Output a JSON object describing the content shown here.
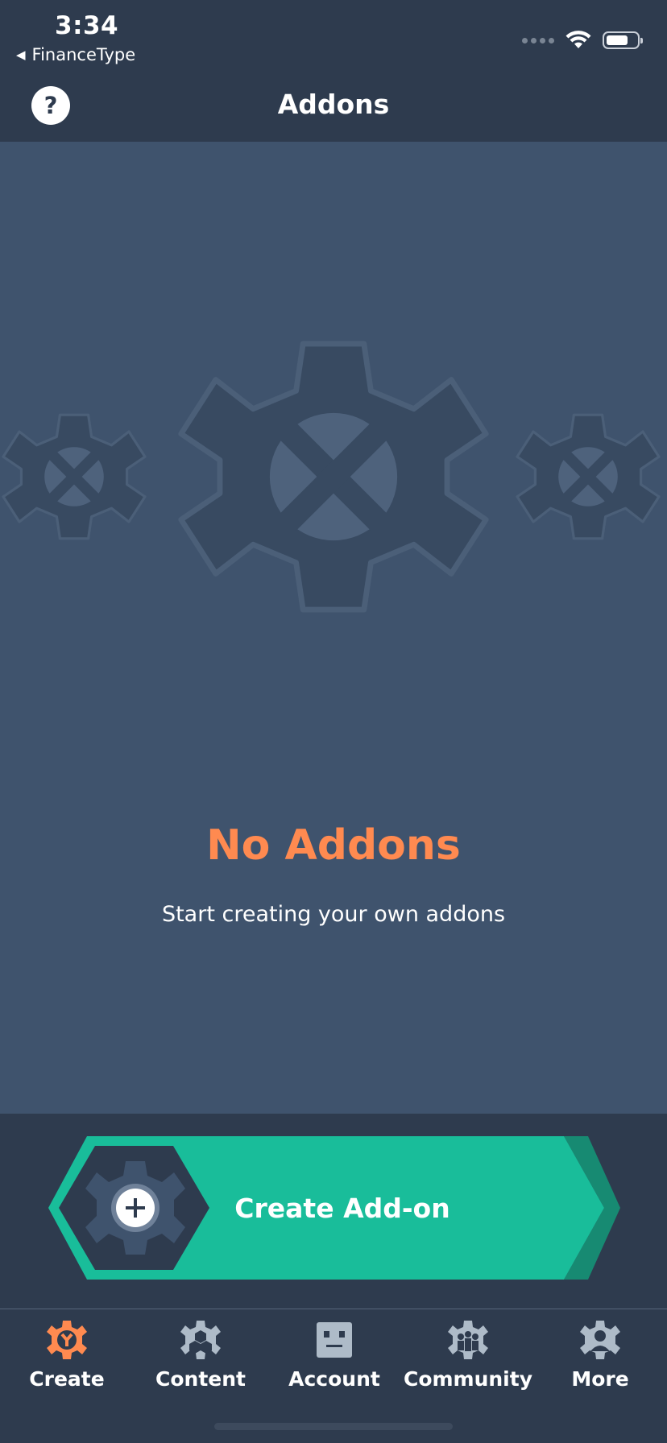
{
  "status_bar": {
    "time": "3:34",
    "back_app": "FinanceType",
    "back_arrow": "◀"
  },
  "header": {
    "help_label": "?",
    "title": "Addons"
  },
  "empty_state": {
    "illustration": "gear-x-icon",
    "title": "No Addons",
    "subtitle": "Start creating your own addons"
  },
  "create_button": {
    "label": "Create Add-on",
    "icon": "gear-plus-icon"
  },
  "tabs": [
    {
      "label": "Create",
      "icon": "create-gear-wrench-icon",
      "active": true
    },
    {
      "label": "Content",
      "icon": "content-hex-icon",
      "active": false
    },
    {
      "label": "Account",
      "icon": "account-face-icon",
      "active": false
    },
    {
      "label": "Community",
      "icon": "community-people-icon",
      "active": false
    },
    {
      "label": "More",
      "icon": "more-person-gear-icon",
      "active": false
    }
  ],
  "colors": {
    "background": "#3f536d",
    "bar": "#2e3b4e",
    "accent_orange": "#ff8a50",
    "accent_green": "#19bd9a",
    "accent_green_dark": "#178a72",
    "tab_icon": "#aebbc8"
  }
}
